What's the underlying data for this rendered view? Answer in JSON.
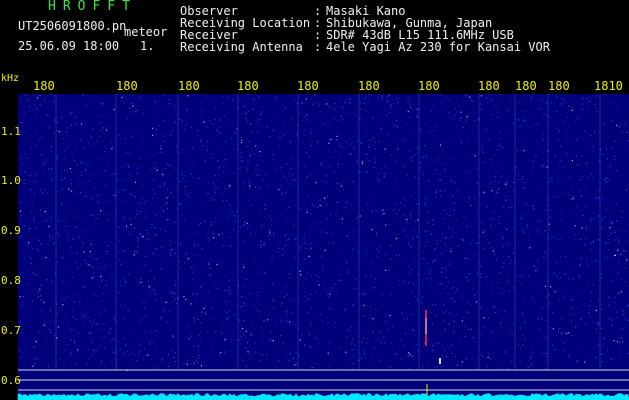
{
  "header": {
    "app_title": "HROFFT",
    "filename": "UT2506091800.pn",
    "mode": "meteor",
    "datetime": "25.06.09 18:00",
    "page": "1.",
    "info": [
      {
        "label": "Observer",
        "value": "Masaki Kano"
      },
      {
        "label": "Receiving Location",
        "value": "Shibukawa, Gunma, Japan"
      },
      {
        "label": "Receiver",
        "value": "SDR# 43dB L15 111.6MHz USB"
      },
      {
        "label": "Receiving Antenna",
        "value": "4ele Yagi Az 230 for Kansai VOR"
      }
    ],
    "colon": ":"
  },
  "spectrogram": {
    "unit_label": "kHz",
    "time_ticks": [
      "180",
      "180",
      "180",
      "180",
      "180",
      "180",
      "180",
      "180",
      "180",
      "180",
      "1810"
    ],
    "freq_ticks": [
      "1.1",
      "1.0",
      "0.9",
      "0.8",
      "0.7",
      "0.6"
    ],
    "colors": {
      "background": "#00007a",
      "noise": "#3a5aff",
      "grid": "#1a2aa0",
      "axis_text": "#f0f000",
      "meteor": "#ff3030",
      "trace": "#00e8ff"
    }
  }
}
